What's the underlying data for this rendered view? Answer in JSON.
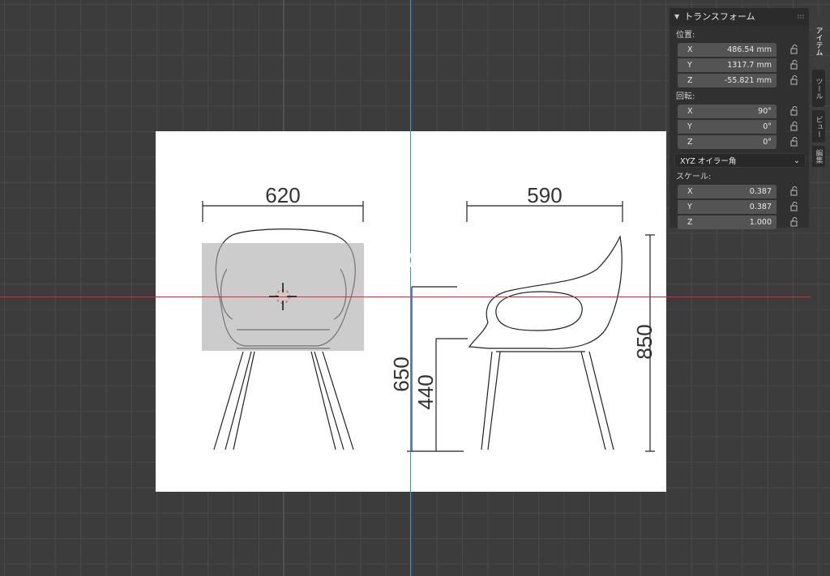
{
  "panel": {
    "title": "トランスフォーム",
    "location_label": "位置:",
    "location": [
      {
        "axis": "X",
        "value": "486.54 mm"
      },
      {
        "axis": "Y",
        "value": "1317.7 mm"
      },
      {
        "axis": "Z",
        "value": "-55.821 mm"
      }
    ],
    "rotation_label": "回転:",
    "rotation": [
      {
        "axis": "X",
        "value": "90°"
      },
      {
        "axis": "Y",
        "value": "0°"
      },
      {
        "axis": "Z",
        "value": "0°"
      }
    ],
    "rotation_mode": "XYZ オイラー角",
    "scale_label": "スケール:",
    "scale": [
      {
        "axis": "X",
        "value": "0.387"
      },
      {
        "axis": "Y",
        "value": "0.387"
      },
      {
        "axis": "Z",
        "value": "1.000"
      }
    ]
  },
  "tabs": {
    "item": "アイテム",
    "tool": "ツール",
    "view": "ビュー",
    "edit": "編集"
  },
  "reference_image": {
    "front_width": "620",
    "side_depth": "590",
    "arm_height": "650",
    "seat_height": "440",
    "total_height": "850"
  },
  "icons": {
    "lock": "lock-icon",
    "gizmo": "move-gizmo-icon",
    "cursor": "3d-cursor-icon",
    "dropdown": "chevron-down-icon"
  },
  "colors": {
    "x_axis": "#a04545",
    "y_axis": "#3d5a96",
    "panel_bg": "#303030",
    "field_bg": "#545454"
  }
}
